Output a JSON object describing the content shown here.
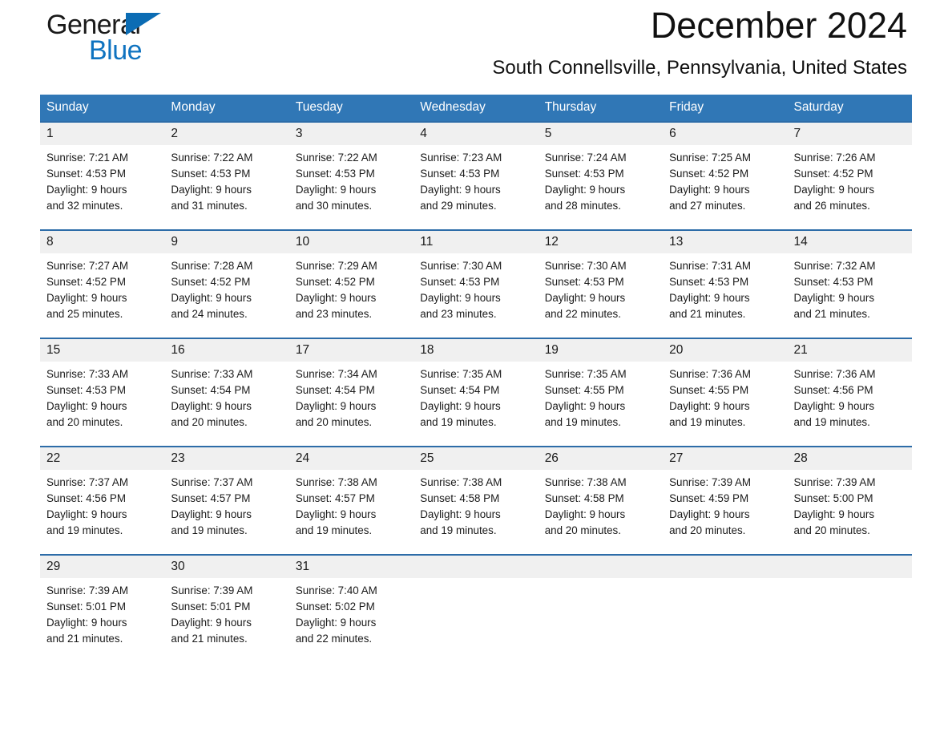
{
  "brand": {
    "name_part1": "General",
    "name_part2": "Blue",
    "accent_color": "#0f73c0",
    "triangle_color": "#0b6cb4"
  },
  "header": {
    "title": "December 2024",
    "subtitle": "South Connellsville, Pennsylvania, United States"
  },
  "theme": {
    "header_row_bg": "#3077b6",
    "week_divider": "#2d6ca8",
    "daynum_bg": "#f0f0f0"
  },
  "calendar": {
    "weekday_headers": [
      "Sunday",
      "Monday",
      "Tuesday",
      "Wednesday",
      "Thursday",
      "Friday",
      "Saturday"
    ],
    "weeks": [
      [
        {
          "day": "1",
          "sunrise": "Sunrise: 7:21 AM",
          "sunset": "Sunset: 4:53 PM",
          "daylight_line1": "Daylight: 9 hours",
          "daylight_line2": "and 32 minutes."
        },
        {
          "day": "2",
          "sunrise": "Sunrise: 7:22 AM",
          "sunset": "Sunset: 4:53 PM",
          "daylight_line1": "Daylight: 9 hours",
          "daylight_line2": "and 31 minutes."
        },
        {
          "day": "3",
          "sunrise": "Sunrise: 7:22 AM",
          "sunset": "Sunset: 4:53 PM",
          "daylight_line1": "Daylight: 9 hours",
          "daylight_line2": "and 30 minutes."
        },
        {
          "day": "4",
          "sunrise": "Sunrise: 7:23 AM",
          "sunset": "Sunset: 4:53 PM",
          "daylight_line1": "Daylight: 9 hours",
          "daylight_line2": "and 29 minutes."
        },
        {
          "day": "5",
          "sunrise": "Sunrise: 7:24 AM",
          "sunset": "Sunset: 4:53 PM",
          "daylight_line1": "Daylight: 9 hours",
          "daylight_line2": "and 28 minutes."
        },
        {
          "day": "6",
          "sunrise": "Sunrise: 7:25 AM",
          "sunset": "Sunset: 4:52 PM",
          "daylight_line1": "Daylight: 9 hours",
          "daylight_line2": "and 27 minutes."
        },
        {
          "day": "7",
          "sunrise": "Sunrise: 7:26 AM",
          "sunset": "Sunset: 4:52 PM",
          "daylight_line1": "Daylight: 9 hours",
          "daylight_line2": "and 26 minutes."
        }
      ],
      [
        {
          "day": "8",
          "sunrise": "Sunrise: 7:27 AM",
          "sunset": "Sunset: 4:52 PM",
          "daylight_line1": "Daylight: 9 hours",
          "daylight_line2": "and 25 minutes."
        },
        {
          "day": "9",
          "sunrise": "Sunrise: 7:28 AM",
          "sunset": "Sunset: 4:52 PM",
          "daylight_line1": "Daylight: 9 hours",
          "daylight_line2": "and 24 minutes."
        },
        {
          "day": "10",
          "sunrise": "Sunrise: 7:29 AM",
          "sunset": "Sunset: 4:52 PM",
          "daylight_line1": "Daylight: 9 hours",
          "daylight_line2": "and 23 minutes."
        },
        {
          "day": "11",
          "sunrise": "Sunrise: 7:30 AM",
          "sunset": "Sunset: 4:53 PM",
          "daylight_line1": "Daylight: 9 hours",
          "daylight_line2": "and 23 minutes."
        },
        {
          "day": "12",
          "sunrise": "Sunrise: 7:30 AM",
          "sunset": "Sunset: 4:53 PM",
          "daylight_line1": "Daylight: 9 hours",
          "daylight_line2": "and 22 minutes."
        },
        {
          "day": "13",
          "sunrise": "Sunrise: 7:31 AM",
          "sunset": "Sunset: 4:53 PM",
          "daylight_line1": "Daylight: 9 hours",
          "daylight_line2": "and 21 minutes."
        },
        {
          "day": "14",
          "sunrise": "Sunrise: 7:32 AM",
          "sunset": "Sunset: 4:53 PM",
          "daylight_line1": "Daylight: 9 hours",
          "daylight_line2": "and 21 minutes."
        }
      ],
      [
        {
          "day": "15",
          "sunrise": "Sunrise: 7:33 AM",
          "sunset": "Sunset: 4:53 PM",
          "daylight_line1": "Daylight: 9 hours",
          "daylight_line2": "and 20 minutes."
        },
        {
          "day": "16",
          "sunrise": "Sunrise: 7:33 AM",
          "sunset": "Sunset: 4:54 PM",
          "daylight_line1": "Daylight: 9 hours",
          "daylight_line2": "and 20 minutes."
        },
        {
          "day": "17",
          "sunrise": "Sunrise: 7:34 AM",
          "sunset": "Sunset: 4:54 PM",
          "daylight_line1": "Daylight: 9 hours",
          "daylight_line2": "and 20 minutes."
        },
        {
          "day": "18",
          "sunrise": "Sunrise: 7:35 AM",
          "sunset": "Sunset: 4:54 PM",
          "daylight_line1": "Daylight: 9 hours",
          "daylight_line2": "and 19 minutes."
        },
        {
          "day": "19",
          "sunrise": "Sunrise: 7:35 AM",
          "sunset": "Sunset: 4:55 PM",
          "daylight_line1": "Daylight: 9 hours",
          "daylight_line2": "and 19 minutes."
        },
        {
          "day": "20",
          "sunrise": "Sunrise: 7:36 AM",
          "sunset": "Sunset: 4:55 PM",
          "daylight_line1": "Daylight: 9 hours",
          "daylight_line2": "and 19 minutes."
        },
        {
          "day": "21",
          "sunrise": "Sunrise: 7:36 AM",
          "sunset": "Sunset: 4:56 PM",
          "daylight_line1": "Daylight: 9 hours",
          "daylight_line2": "and 19 minutes."
        }
      ],
      [
        {
          "day": "22",
          "sunrise": "Sunrise: 7:37 AM",
          "sunset": "Sunset: 4:56 PM",
          "daylight_line1": "Daylight: 9 hours",
          "daylight_line2": "and 19 minutes."
        },
        {
          "day": "23",
          "sunrise": "Sunrise: 7:37 AM",
          "sunset": "Sunset: 4:57 PM",
          "daylight_line1": "Daylight: 9 hours",
          "daylight_line2": "and 19 minutes."
        },
        {
          "day": "24",
          "sunrise": "Sunrise: 7:38 AM",
          "sunset": "Sunset: 4:57 PM",
          "daylight_line1": "Daylight: 9 hours",
          "daylight_line2": "and 19 minutes."
        },
        {
          "day": "25",
          "sunrise": "Sunrise: 7:38 AM",
          "sunset": "Sunset: 4:58 PM",
          "daylight_line1": "Daylight: 9 hours",
          "daylight_line2": "and 19 minutes."
        },
        {
          "day": "26",
          "sunrise": "Sunrise: 7:38 AM",
          "sunset": "Sunset: 4:58 PM",
          "daylight_line1": "Daylight: 9 hours",
          "daylight_line2": "and 20 minutes."
        },
        {
          "day": "27",
          "sunrise": "Sunrise: 7:39 AM",
          "sunset": "Sunset: 4:59 PM",
          "daylight_line1": "Daylight: 9 hours",
          "daylight_line2": "and 20 minutes."
        },
        {
          "day": "28",
          "sunrise": "Sunrise: 7:39 AM",
          "sunset": "Sunset: 5:00 PM",
          "daylight_line1": "Daylight: 9 hours",
          "daylight_line2": "and 20 minutes."
        }
      ],
      [
        {
          "day": "29",
          "sunrise": "Sunrise: 7:39 AM",
          "sunset": "Sunset: 5:01 PM",
          "daylight_line1": "Daylight: 9 hours",
          "daylight_line2": "and 21 minutes."
        },
        {
          "day": "30",
          "sunrise": "Sunrise: 7:39 AM",
          "sunset": "Sunset: 5:01 PM",
          "daylight_line1": "Daylight: 9 hours",
          "daylight_line2": "and 21 minutes."
        },
        {
          "day": "31",
          "sunrise": "Sunrise: 7:40 AM",
          "sunset": "Sunset: 5:02 PM",
          "daylight_line1": "Daylight: 9 hours",
          "daylight_line2": "and 22 minutes."
        },
        {
          "day": "",
          "sunrise": "",
          "sunset": "",
          "daylight_line1": "",
          "daylight_line2": ""
        },
        {
          "day": "",
          "sunrise": "",
          "sunset": "",
          "daylight_line1": "",
          "daylight_line2": ""
        },
        {
          "day": "",
          "sunrise": "",
          "sunset": "",
          "daylight_line1": "",
          "daylight_line2": ""
        },
        {
          "day": "",
          "sunrise": "",
          "sunset": "",
          "daylight_line1": "",
          "daylight_line2": ""
        }
      ]
    ]
  }
}
